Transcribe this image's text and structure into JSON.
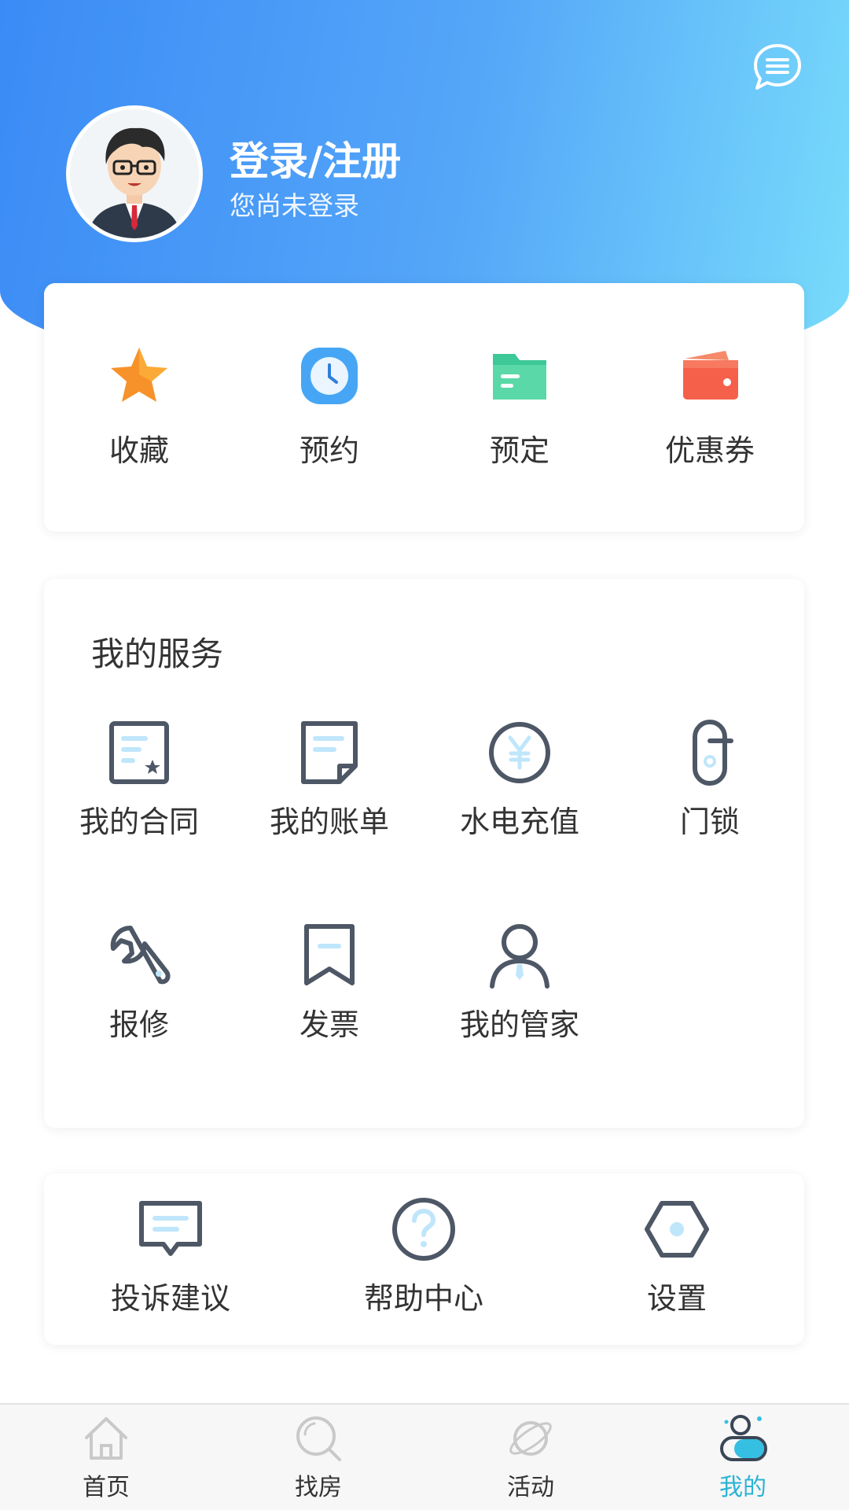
{
  "header": {
    "login_title": "登录/注册",
    "login_subtitle": "您尚未登录",
    "message_icon": "chat-bubble-icon",
    "avatar_icon": "default-avatar"
  },
  "quick_actions": [
    {
      "label": "收藏",
      "icon": "star-icon",
      "color": "#f7922a"
    },
    {
      "label": "预约",
      "icon": "clock-icon",
      "color": "#46a6f5"
    },
    {
      "label": "预定",
      "icon": "folder-icon",
      "color": "#3dc898"
    },
    {
      "label": "优惠券",
      "icon": "wallet-icon",
      "color": "#f5604a"
    }
  ],
  "services": {
    "title": "我的服务",
    "items": [
      {
        "label": "我的合同",
        "icon": "contract-icon"
      },
      {
        "label": "我的账单",
        "icon": "bill-icon"
      },
      {
        "label": "水电充值",
        "icon": "yen-coin-icon"
      },
      {
        "label": "门锁",
        "icon": "door-lock-icon"
      },
      {
        "label": "报修",
        "icon": "wrench-icon"
      },
      {
        "label": "发票",
        "icon": "invoice-icon"
      },
      {
        "label": "我的管家",
        "icon": "butler-icon"
      }
    ]
  },
  "misc": [
    {
      "label": "投诉建议",
      "icon": "feedback-icon"
    },
    {
      "label": "帮助中心",
      "icon": "help-icon"
    },
    {
      "label": "设置",
      "icon": "settings-hexagon-icon"
    }
  ],
  "tabbar": [
    {
      "label": "首页",
      "icon": "home-icon",
      "active": false
    },
    {
      "label": "找房",
      "icon": "search-icon",
      "active": false
    },
    {
      "label": "活动",
      "icon": "planet-icon",
      "active": false
    },
    {
      "label": "我的",
      "icon": "profile-icon",
      "active": true
    }
  ],
  "colors": {
    "header_gradient_start": "#3b8bf6",
    "header_gradient_end": "#79dcfb",
    "icon_gray": "#4d5766",
    "icon_accent": "#bfe6fb",
    "tab_active": "#2bb3d6"
  }
}
